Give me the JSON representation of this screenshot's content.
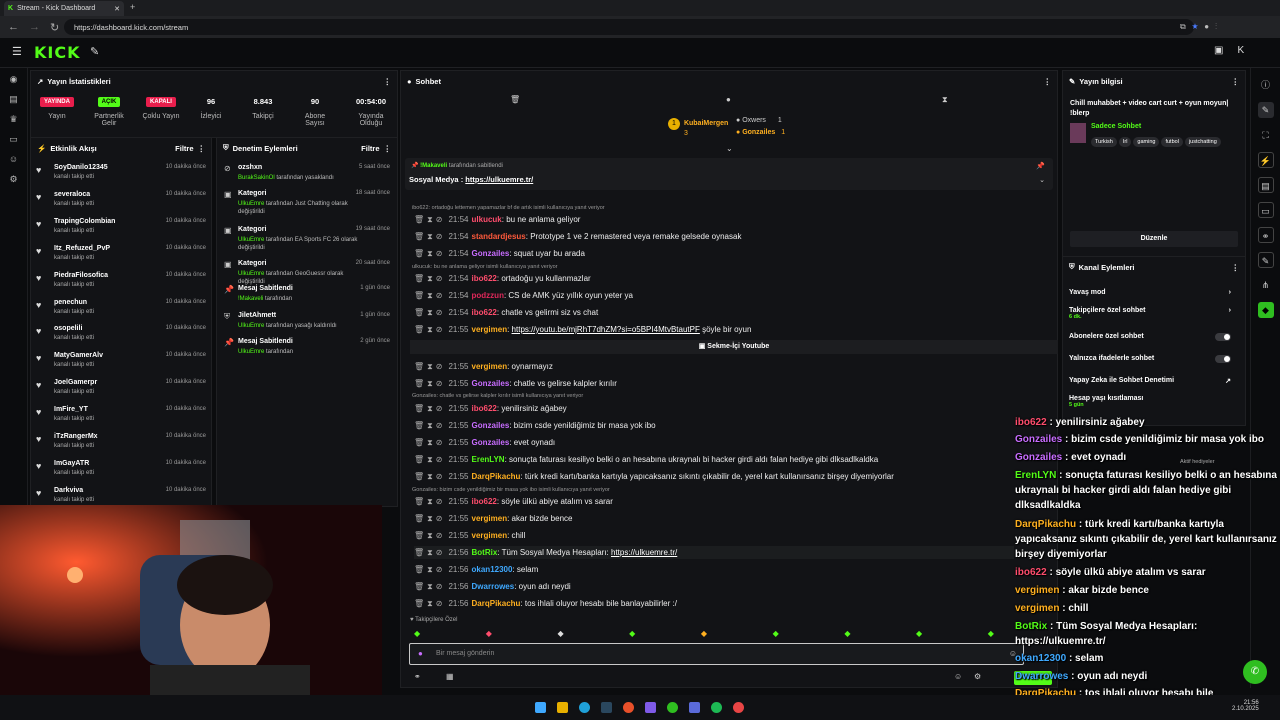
{
  "browser": {
    "tab_title": "Stream - Kick Dashboard",
    "url": "https://dashboard.kick.com/stream"
  },
  "brand": {
    "logo": "KICK",
    "accent": "#53fc18"
  },
  "stats": {
    "title": "Yayın İstatistikleri",
    "items": [
      {
        "pill": "YAYINDA",
        "label": "Yayın",
        "color": "#e91e4c"
      },
      {
        "pill": "AÇIK",
        "label": "Partnerlik Gelir",
        "color": "#53fc18"
      },
      {
        "pill": "KAPALI",
        "label": "Çoklu Yayın",
        "color": "#e91e4c"
      },
      {
        "value": "96",
        "label": "İzleyici"
      },
      {
        "value": "8.843",
        "label": "Takipçi"
      },
      {
        "value": "90",
        "label": "Abone Sayısı"
      },
      {
        "value": "00:54:00",
        "label": "Yayında Olduğu"
      }
    ]
  },
  "activity": {
    "title": "Etkinlik Akışı",
    "filter": "Filtre",
    "rows": [
      {
        "name": "SoyDanilo12345",
        "sub": "kanalı takip etti",
        "time": "10 dakika önce"
      },
      {
        "name": "severaloca",
        "sub": "kanalı takip etti",
        "time": "10 dakika önce"
      },
      {
        "name": "TrapingColombian",
        "sub": "kanalı takip etti",
        "time": "10 dakika önce"
      },
      {
        "name": "Itz_Refuzed_PvP",
        "sub": "kanalı takip etti",
        "time": "10 dakika önce"
      },
      {
        "name": "PiedraFilosofica",
        "sub": "kanalı takip etti",
        "time": "10 dakika önce"
      },
      {
        "name": "penechun",
        "sub": "kanalı takip etti",
        "time": "10 dakika önce"
      },
      {
        "name": "osopelili",
        "sub": "kanalı takip etti",
        "time": "10 dakika önce"
      },
      {
        "name": "MatyGamerAlv",
        "sub": "kanalı takip etti",
        "time": "10 dakika önce"
      },
      {
        "name": "JoelGamerpr",
        "sub": "kanalı takip etti",
        "time": "10 dakika önce"
      },
      {
        "name": "ImFire_YT",
        "sub": "kanalı takip etti",
        "time": "10 dakika önce"
      },
      {
        "name": "iTzRangerMx",
        "sub": "kanalı takip etti",
        "time": "10 dakika önce"
      },
      {
        "name": "ImGayATR",
        "sub": "kanalı takip etti",
        "time": "10 dakika önce"
      },
      {
        "name": "Darkviva",
        "sub": "kanalı takip etti",
        "time": "10 dakika önce"
      }
    ]
  },
  "moderation": {
    "title": "Denetim Eylemleri",
    "filter": "Filtre",
    "rows": [
      {
        "name": "ozshxn",
        "who": "BurakSakinOl",
        "rest": "tarafından yasaklandı",
        "time": "5 saat önce"
      },
      {
        "name": "Kategori",
        "who": "UlkuEmre",
        "rest": "tarafından Just Chatting olarak değiştirildi",
        "time": "18 saat önce"
      },
      {
        "name": "Kategori",
        "who": "UlkuEmre",
        "rest": "tarafından EA Sports FC 26 olarak değiştirildi",
        "time": "19 saat önce"
      },
      {
        "name": "Kategori",
        "who": "UlkuEmre",
        "rest": "tarafından GeoGuessr olarak değiştirildi",
        "time": "20 saat önce"
      },
      {
        "name": "Mesaj Sabitlendi",
        "who": "!Makaveli",
        "rest": "tarafından",
        "time": "1 gün önce"
      },
      {
        "name": "JiletAhmett",
        "who": "UlkuEmre",
        "rest": "tarafından yasağı kaldırıldı",
        "time": "1 gün önce"
      },
      {
        "name": "Mesaj Sabitlendi",
        "who": "UlkuEmre",
        "rest": "tarafından",
        "time": "2 gün önce"
      }
    ]
  },
  "chat": {
    "title": "Sohbet",
    "leaders": [
      {
        "name": "KubaiMergen",
        "count": "3"
      },
      {
        "name": "Oxwers",
        "count": "1"
      },
      {
        "name": "Gonzailes",
        "count": "1"
      }
    ],
    "pinned_by": "!Makaveli",
    "pinned_suffix": "tarafından sabitlendi",
    "pinned_text": "Sosyal Medya :",
    "pinned_link": "https://ulkuemre.tr/",
    "youtube_btn": "Sekme-İçi Youtube",
    "followers_only": "Takipçilere Özel",
    "input_placeholder": "Bir mesaj gönderin",
    "send_label": "Sohbet",
    "messages": [
      {
        "type": "reply",
        "text": "ibo622: ortadoğu lettemen yapamazlar bf de artık isimli kullanıcıya yanıt veriyor"
      },
      {
        "time": "21:54",
        "user": "ulkucuk",
        "color": "#ff4d6d",
        "text": "bu ne anlama geliyor"
      },
      {
        "time": "21:54",
        "user": "standardjesus",
        "color": "#ff5a3c",
        "text": "Prototype 1 ve 2 remastered veya remake gelsede oynasak"
      },
      {
        "time": "21:54",
        "user": "Gonzailes",
        "color": "#c86dff",
        "text": "squat uyar bu arada"
      },
      {
        "type": "reply",
        "text": "ulkucuk: bu ne anlama geliyor isimli kullanıcıya yanıt veriyor"
      },
      {
        "time": "21:54",
        "user": "ibo622",
        "color": "#ff4d6d",
        "text": "ortadoğu yu kullanmazlar"
      },
      {
        "time": "21:54",
        "user": "podzzun",
        "color": "#e0285a",
        "text": "CS de AMK yüz yıllık oyun yeter ya"
      },
      {
        "time": "21:54",
        "user": "ibo622",
        "color": "#ff4d6d",
        "text": "chatle vs gelirmi siz vs chat"
      },
      {
        "time": "21:55",
        "user": "vergimen",
        "color": "#ffb020",
        "text": "https://youtu.be/mjRhT7dhZM?si=o5BPI4MtvBtautPF",
        "suffix": "şöyle bir oyun",
        "link": true
      },
      {
        "time": "21:55",
        "user": "vergimen",
        "color": "#ffb020",
        "text": "oynarmayız"
      },
      {
        "time": "21:55",
        "user": "Gonzailes",
        "color": "#c86dff",
        "text": "chatle vs gelirse kalpler kırılır"
      },
      {
        "type": "reply",
        "text": "Gonzailes: chatle vs gelirse kalpler kırılır isimli kullanıcıya yanıt veriyor"
      },
      {
        "time": "21:55",
        "user": "ibo622",
        "color": "#ff4d6d",
        "text": "yenilirsiniz ağabey"
      },
      {
        "time": "21:55",
        "user": "Gonzailes",
        "color": "#c86dff",
        "text": "bizim csde yenildiğimiz bir masa yok ibo"
      },
      {
        "time": "21:55",
        "user": "Gonzailes",
        "color": "#c86dff",
        "text": "evet oynadı"
      },
      {
        "time": "21:55",
        "user": "ErenLYN",
        "color": "#53fc18",
        "text": "sonuçta faturası kesiliyo belki o an hesabına ukraynalı bi hacker girdi aldı falan hediye gibi dlksadlkaldka"
      },
      {
        "time": "21:55",
        "user": "DarqPikachu",
        "color": "#ffb020",
        "text": "türk kredi kartı/banka kartıyla yapıcaksanız sıkıntı çıkabilir de, yerel kart kullanırsanız birşey diyemiyorlar"
      },
      {
        "type": "reply",
        "text": "Gonzailes: bizim csde yenildiğimiz bir masa yok ibo isimli kullanıcıya yanıt veriyor"
      },
      {
        "time": "21:55",
        "user": "ibo622",
        "color": "#ff4d6d",
        "text": "söyle ülkü abiye atalım vs sarar"
      },
      {
        "time": "21:55",
        "user": "vergimen",
        "color": "#ffb020",
        "text": "akar bizde bence"
      },
      {
        "time": "21:55",
        "user": "vergimen",
        "color": "#ffb020",
        "text": "chill"
      },
      {
        "time": "21:56",
        "user": "BotRix",
        "color": "#53fc18",
        "text": "Tüm Sosyal Medya Hesapları:",
        "suffix": "https://ulkuemre.tr/",
        "suffix_link": true
      },
      {
        "time": "21:56",
        "user": "okan12300",
        "color": "#3fa9ff",
        "text": "selam"
      },
      {
        "time": "21:56",
        "user": "Dwarrowes",
        "color": "#3fa9ff",
        "text": "oyun adı neydi"
      },
      {
        "time": "21:56",
        "user": "DarqPikachu",
        "color": "#ffb020",
        "text": "tos ihlali oluyor hesabı bile banlayabilirler :/"
      }
    ]
  },
  "stream_info": {
    "title": "Yayın bilgisi",
    "stream_title": "Chill muhabbet + video cart curt + oyun moyun| !blerp",
    "category": "Sadece Sohbet",
    "tags": [
      "Turkish",
      "Irl",
      "gaming",
      "futbol",
      "justchatting"
    ],
    "edit_btn": "Düzenle"
  },
  "channel_actions": {
    "title": "Kanal Eylemleri",
    "items": [
      {
        "label": "Yavaş mod"
      },
      {
        "label": "Takipçilere özel sohbet",
        "sub": "6 dk."
      },
      {
        "label": "Abonelere özel sohbet"
      },
      {
        "label": "Yalnızca ifadelerle sohbet"
      },
      {
        "label": "Yapay Zeka ile Sohbet Denetimi"
      },
      {
        "label": "Hesap yaşı kısıtlaması",
        "sub": "5 gün"
      }
    ],
    "aktif": "Aktif hediyeler"
  },
  "overlay_chat": [
    {
      "user": "ibo622",
      "color": "#ff4d6d",
      "text": ": yenilirsiniz ağabey"
    },
    {
      "user": "Gonzailes",
      "color": "#c86dff",
      "text": ": bizim csde yenildiğimiz bir masa yok ibo"
    },
    {
      "user": "Gonzailes",
      "color": "#c86dff",
      "text": ": evet oynadı"
    },
    {
      "user": "ErenLYN",
      "color": "#53fc18",
      "text": ": sonuçta faturası kesiliyo belki o an hesabına ukraynalı bi hacker girdi aldı falan hediye gibi dlksadlkaldka"
    },
    {
      "user": "DarqPikachu",
      "color": "#ffb020",
      "text": ": türk kredi kartı/banka kartıyla yapıcaksanız sıkıntı çıkabilir de, yerel kart kullanırsanız birşey diyemiyorlar"
    },
    {
      "user": "ibo622",
      "color": "#ff4d6d",
      "text": ": söyle ülkü abiye atalım vs sarar"
    },
    {
      "user": "vergimen",
      "color": "#ffb020",
      "text": ": akar bizde bence"
    },
    {
      "user": "vergimen",
      "color": "#ffb020",
      "text": ": chill"
    },
    {
      "user": "BotRix",
      "color": "#53fc18",
      "text": ": Tüm Sosyal Medya Hesapları: https://ulkuemre.tr/"
    },
    {
      "user": "okan12300",
      "color": "#3fa9ff",
      "text": ": selam"
    },
    {
      "user": "Dwarrowes",
      "color": "#3fa9ff",
      "text": ": oyun adı neydi"
    },
    {
      "user": "DarqPikachu",
      "color": "#ffb020",
      "text": ": tos ihlali oluyor hesabı bile banlayabilirler :/"
    }
  ],
  "clock": {
    "time": "21:56",
    "date": "2.10.2025"
  }
}
